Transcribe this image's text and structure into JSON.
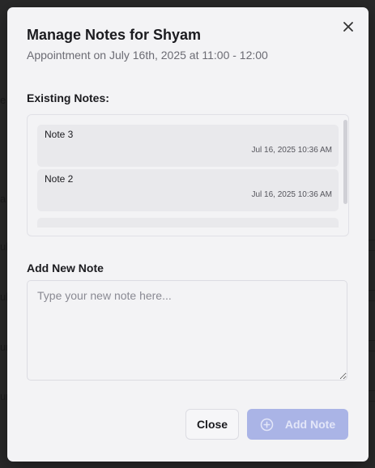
{
  "modal": {
    "title": "Manage Notes for Shyam",
    "subtitle": "Appointment on July 16th, 2025 at 11:00 - 12:00",
    "close_icon": "close-icon"
  },
  "existing_notes": {
    "label": "Existing Notes:",
    "items": [
      {
        "text": "Note 3",
        "timestamp": "Jul 16, 2025 10:36 AM"
      },
      {
        "text": "Note 2",
        "timestamp": "Jul 16, 2025 10:36 AM"
      }
    ]
  },
  "new_note": {
    "label": "Add New Note",
    "placeholder": "Type your new note here...",
    "value": ""
  },
  "actions": {
    "close_label": "Close",
    "add_label": "Add Note",
    "add_icon": "plus-circle-icon",
    "add_disabled": true
  },
  "colors": {
    "modal_bg": "#f3f3f5",
    "note_bg": "#e9e9ec",
    "accent_disabled": "#aab4e6"
  }
}
